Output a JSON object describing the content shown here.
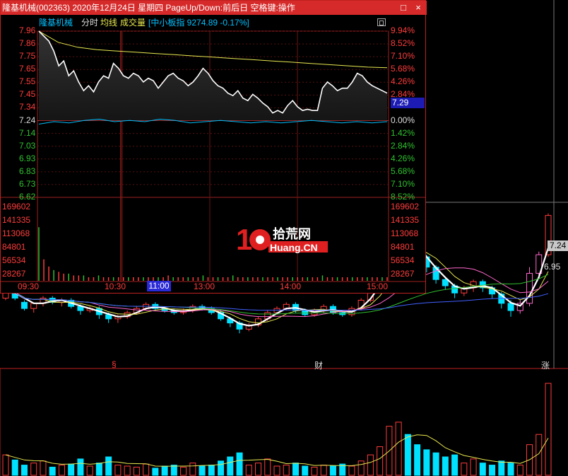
{
  "window": {
    "title": "隆基机械(002363) 2020年12月24日 星期四 PageUp/Down:前后日 空格键:操作",
    "minimize_label": "□",
    "close_label": "×"
  },
  "intraday": {
    "stock_name": "隆基机械",
    "tab_label": "分时",
    "avg_label": "均线",
    "volume_label": "成交量",
    "index_label": "[中小板指 9274.89 -0.17%]",
    "colors": {
      "up": "#ff3c3c",
      "down": "#30c030",
      "index": "#00c0ff",
      "avg": "#e8e850",
      "price": "#ffffff",
      "accent_blue": "#1c1cb4"
    },
    "price_ticks": [
      "7.96",
      "7.86",
      "7.75",
      "7.65",
      "7.55",
      "7.45",
      "7.34",
      "7.24",
      "7.14",
      "7.03",
      "6.93",
      "6.83",
      "6.73",
      "6.62"
    ],
    "pct_ticks": [
      "9.94%",
      "8.52%",
      "7.10%",
      "5.68%",
      "4.26%",
      "2.84%",
      "",
      "0.00%",
      "1.42%",
      "2.84%",
      "4.26%",
      "5.68%",
      "7.10%",
      "8.52%"
    ],
    "current_price": "7.29",
    "volume_ticks": [
      "169602",
      "141335",
      "113068",
      "84801",
      "56534",
      "28267"
    ],
    "time_ticks": [
      "09:30",
      "10:30",
      "11:00",
      "13:00",
      "14:00",
      "15:00"
    ],
    "base_price": 7.24,
    "price_series": [
      7.96,
      7.92,
      7.88,
      7.8,
      7.68,
      7.72,
      7.6,
      7.64,
      7.55,
      7.48,
      7.52,
      7.47,
      7.55,
      7.6,
      7.58,
      7.7,
      7.66,
      7.6,
      7.58,
      7.62,
      7.6,
      7.55,
      7.58,
      7.56,
      7.5,
      7.55,
      7.6,
      7.62,
      7.58,
      7.56,
      7.52,
      7.55,
      7.6,
      7.66,
      7.62,
      7.56,
      7.52,
      7.5,
      7.46,
      7.44,
      7.48,
      7.42,
      7.4,
      7.45,
      7.42,
      7.38,
      7.35,
      7.3,
      7.32,
      7.3,
      7.36,
      7.4,
      7.35,
      7.32,
      7.33,
      7.32,
      7.32,
      7.5,
      7.55,
      7.52,
      7.48,
      7.5,
      7.5,
      7.55,
      7.62,
      7.6,
      7.55,
      7.52,
      7.5,
      7.48,
      7.46
    ],
    "avg_series": [
      7.96,
      7.87,
      7.83,
      7.81,
      7.8,
      7.79,
      7.78,
      7.77,
      7.76,
      7.75,
      7.74,
      7.73,
      7.72,
      7.71,
      7.7,
      7.69,
      7.68,
      7.67,
      7.665
    ],
    "index_series": [
      7.21,
      7.23,
      7.22,
      7.24,
      7.25,
      7.23,
      7.24,
      7.23,
      7.25,
      7.24,
      7.22,
      7.23,
      7.24,
      7.23,
      7.22,
      7.23,
      7.22,
      7.23,
      7.24,
      7.23,
      7.22,
      7.23,
      7.22,
      7.23
    ],
    "volume_series": [
      30,
      12,
      8,
      6,
      5,
      4,
      4,
      3,
      3,
      3,
      2,
      2,
      3,
      2,
      2,
      2,
      2,
      2,
      2,
      2,
      2,
      2,
      2,
      2,
      2,
      2,
      3,
      2,
      2,
      2,
      2,
      2,
      2,
      3,
      2,
      2,
      2,
      2,
      2,
      3,
      2,
      2,
      2,
      2,
      2,
      2,
      2,
      2,
      2,
      2,
      2,
      2,
      2,
      2,
      2,
      2,
      2,
      3,
      2,
      2,
      2,
      2,
      2,
      2,
      2,
      2,
      2,
      2,
      2,
      2,
      2
    ]
  },
  "kline": {
    "last_price_tag": "7.24",
    "low_label": "6.95",
    "marker_left": "§",
    "marker_mid": "财",
    "marker_right": "涨",
    "candles": [
      [
        7.0,
        7.1,
        7.1,
        6.98
      ],
      [
        7.1,
        7.0,
        7.12,
        6.98
      ],
      [
        6.96,
        6.9,
        6.98,
        6.88
      ],
      [
        6.9,
        6.95,
        6.96,
        6.86
      ],
      [
        6.95,
        7.0,
        7.02,
        6.92
      ],
      [
        7.0,
        6.96,
        7.02,
        6.94
      ],
      [
        6.96,
        6.98,
        7.0,
        6.92
      ],
      [
        6.98,
        6.92,
        7.0,
        6.9
      ],
      [
        6.92,
        6.88,
        6.94,
        6.84
      ],
      [
        6.88,
        6.9,
        6.92,
        6.86
      ],
      [
        6.9,
        6.84,
        6.92,
        6.8
      ],
      [
        6.84,
        6.8,
        6.86,
        6.76
      ],
      [
        6.8,
        6.82,
        6.84,
        6.76
      ],
      [
        6.82,
        6.86,
        6.88,
        6.8
      ],
      [
        6.86,
        6.9,
        6.92,
        6.84
      ],
      [
        6.9,
        6.94,
        6.96,
        6.88
      ],
      [
        6.94,
        6.9,
        6.96,
        6.88
      ],
      [
        6.9,
        6.88,
        6.92,
        6.86
      ],
      [
        6.88,
        6.86,
        6.9,
        6.84
      ],
      [
        6.86,
        6.88,
        6.9,
        6.84
      ],
      [
        6.88,
        6.92,
        6.94,
        6.86
      ],
      [
        6.92,
        6.9,
        6.94,
        6.88
      ],
      [
        6.9,
        6.86,
        6.92,
        6.84
      ],
      [
        6.86,
        6.8,
        6.88,
        6.78
      ],
      [
        6.8,
        6.76,
        6.82,
        6.72
      ],
      [
        6.76,
        6.7,
        6.78,
        6.66
      ],
      [
        6.7,
        6.74,
        6.76,
        6.68
      ],
      [
        6.74,
        6.8,
        6.82,
        6.72
      ],
      [
        6.8,
        6.86,
        6.88,
        6.78
      ],
      [
        6.86,
        6.9,
        6.92,
        6.84
      ],
      [
        6.9,
        6.94,
        6.96,
        6.88
      ],
      [
        6.94,
        6.88,
        6.96,
        6.86
      ],
      [
        6.88,
        6.84,
        6.9,
        6.82
      ],
      [
        6.84,
        6.88,
        6.9,
        6.82
      ],
      [
        6.88,
        6.92,
        6.94,
        6.86
      ],
      [
        6.92,
        6.86,
        6.94,
        6.84
      ],
      [
        6.86,
        6.84,
        6.88,
        6.82
      ],
      [
        6.84,
        6.9,
        6.92,
        6.82
      ],
      [
        6.9,
        6.98,
        7.0,
        6.88
      ],
      [
        6.98,
        7.1,
        7.12,
        6.96
      ],
      [
        7.1,
        7.28,
        7.3,
        7.08
      ],
      [
        7.28,
        7.45,
        7.5,
        7.25
      ],
      [
        7.45,
        7.55,
        7.62,
        7.4
      ],
      [
        7.55,
        7.5,
        7.6,
        7.42
      ],
      [
        7.5,
        7.4,
        7.52,
        7.35
      ],
      [
        7.4,
        7.3,
        7.42,
        7.25
      ],
      [
        7.3,
        7.18,
        7.32,
        7.14
      ],
      [
        7.18,
        7.12,
        7.2,
        7.08
      ],
      [
        7.12,
        7.05,
        7.14,
        7.0
      ],
      [
        7.05,
        7.1,
        7.12,
        7.02
      ],
      [
        7.1,
        7.16,
        7.18,
        7.06
      ],
      [
        7.16,
        7.1,
        7.18,
        7.06
      ],
      [
        7.1,
        7.04,
        7.12,
        7.0
      ],
      [
        7.04,
        6.95,
        7.06,
        6.9
      ],
      [
        6.95,
        6.88,
        6.98,
        6.82
      ],
      [
        6.88,
        6.95,
        6.98,
        6.85
      ],
      [
        6.95,
        7.24,
        7.3,
        6.92
      ],
      [
        7.24,
        7.42,
        7.45,
        7.2
      ],
      [
        7.42,
        7.8,
        7.82,
        7.4
      ]
    ],
    "volumes": [
      20,
      15,
      10,
      12,
      14,
      8,
      10,
      11,
      16,
      9,
      12,
      18,
      10,
      9,
      8,
      11,
      7,
      9,
      10,
      8,
      12,
      9,
      10,
      14,
      18,
      22,
      10,
      12,
      16,
      9,
      10,
      12,
      9,
      8,
      10,
      9,
      11,
      9,
      14,
      20,
      28,
      48,
      52,
      40,
      30,
      25,
      22,
      18,
      20,
      12,
      16,
      12,
      10,
      14,
      12,
      10,
      30,
      40,
      90
    ]
  }
}
